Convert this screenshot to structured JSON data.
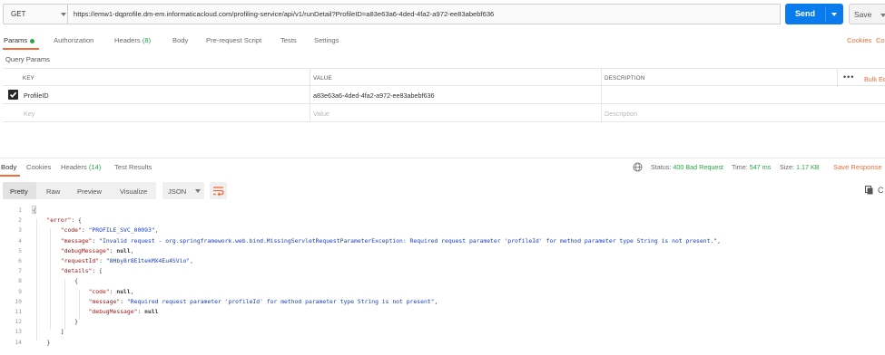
{
  "request": {
    "method": "GET",
    "url": "https://emw1-dqprofile.dm-em.informaticacloud.com/profiling-service/api/v1/runDetail?ProfileID=a83e63a6-4ded-4fa2-a972-ee83abebf636",
    "send_label": "Send",
    "save_label": "Save"
  },
  "request_tabs": [
    {
      "label": "Params"
    },
    {
      "label": "Authorization"
    },
    {
      "label": "Headers",
      "count": "(8)"
    },
    {
      "label": "Body"
    },
    {
      "label": "Pre-request Script"
    },
    {
      "label": "Tests"
    },
    {
      "label": "Settings"
    }
  ],
  "right_links": {
    "cookies": "Cookies",
    "code": "Co"
  },
  "query_params": {
    "title": "Query Params",
    "headers": [
      "KEY",
      "VALUE",
      "DESCRIPTION"
    ],
    "rows": [
      {
        "checked": true,
        "key": "ProfileID",
        "value": "a83e63a6-4ded-4fa2-a972-ee83abebf636",
        "description": ""
      }
    ],
    "placeholder": {
      "key": "Key",
      "value": "Value",
      "description": "Description"
    },
    "more": "•••",
    "bulk_edit": "Bulk Ed"
  },
  "response_tabs": [
    {
      "label": "Body"
    },
    {
      "label": "Cookies"
    },
    {
      "label": "Headers",
      "count": "(14)"
    },
    {
      "label": "Test Results"
    }
  ],
  "status": {
    "status_label": "Status:",
    "status_value": "400 Bad Request",
    "time_label": "Time:",
    "time_value": "547 ms",
    "size_label": "Size:",
    "size_value": "1.17 KB",
    "save_response": "Save Response"
  },
  "view": {
    "modes": [
      "Pretty",
      "Raw",
      "Preview",
      "Visualize"
    ],
    "format": "JSON"
  },
  "body_lines": [
    {
      "n": "1",
      "text": "{"
    },
    {
      "n": "2",
      "text": "    \"error\": {"
    },
    {
      "n": "3",
      "text": "        \"code\": \"PROFILE_SVC_00093\","
    },
    {
      "n": "4",
      "text": "        \"message\": \"Invalid request - org.springframework.web.bind.MissingServletRequestParameterException: Required request parameter 'profileId' for method parameter type String is not present.\","
    },
    {
      "n": "5",
      "text": "        \"debugMessage\": null,"
    },
    {
      "n": "6",
      "text": "        \"requestId\": \"8Hby8r8E1tekMX4Eu4SVio\","
    },
    {
      "n": "7",
      "text": "        \"details\": ["
    },
    {
      "n": "8",
      "text": "            {"
    },
    {
      "n": "9",
      "text": "                \"code\": null,"
    },
    {
      "n": "10",
      "text": "                \"message\": \"Required request parameter 'profileId' for method parameter type String is not present\","
    },
    {
      "n": "11",
      "text": "                \"debugMessage\": null"
    },
    {
      "n": "12",
      "text": "            }"
    },
    {
      "n": "13",
      "text": "        ]"
    },
    {
      "n": "14",
      "text": "    }"
    }
  ],
  "colors": {
    "send": "#097bed",
    "accent": "#f26b3a",
    "success": "#28a745",
    "key": "#a01818",
    "string": "#1a3ec0"
  }
}
